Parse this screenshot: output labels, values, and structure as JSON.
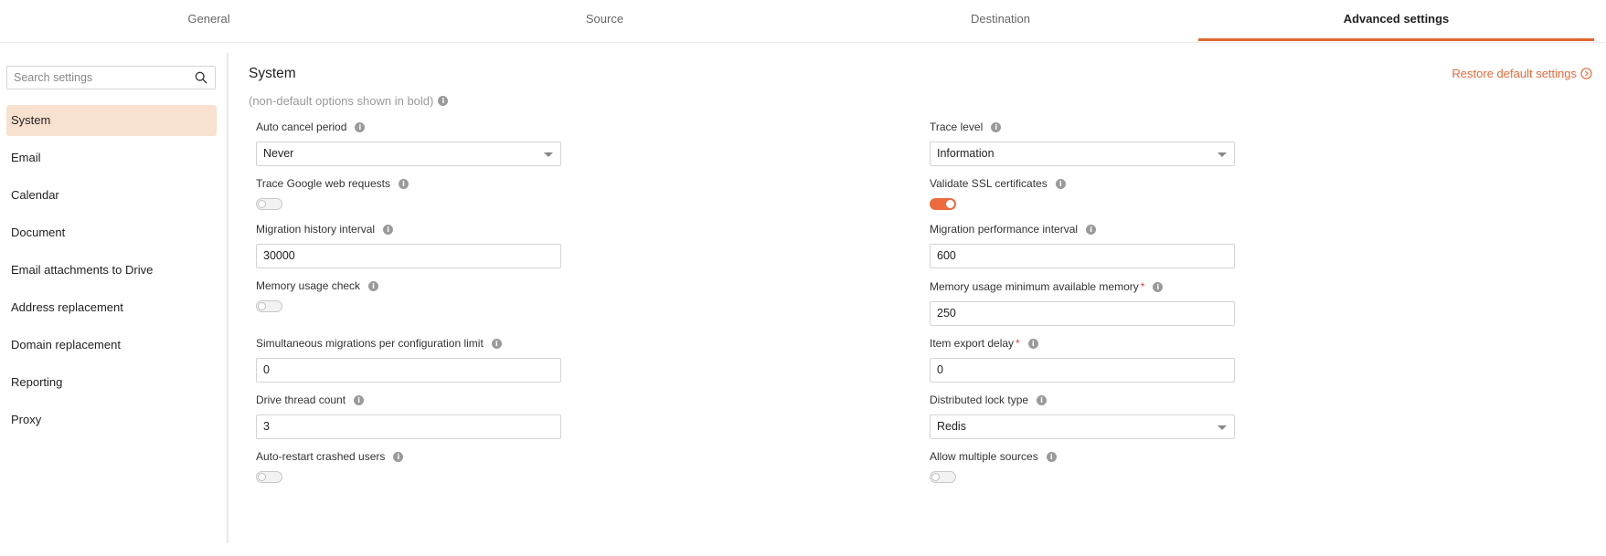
{
  "tabs": [
    {
      "label": "General"
    },
    {
      "label": "Source"
    },
    {
      "label": "Destination"
    },
    {
      "label": "Advanced settings",
      "active": true
    }
  ],
  "sidebar": {
    "search_placeholder": "Search settings",
    "items": [
      {
        "label": "System",
        "active": true
      },
      {
        "label": "Email"
      },
      {
        "label": "Calendar"
      },
      {
        "label": "Document"
      },
      {
        "label": "Email attachments to Drive"
      },
      {
        "label": "Address replacement"
      },
      {
        "label": "Domain replacement"
      },
      {
        "label": "Reporting"
      },
      {
        "label": "Proxy"
      }
    ]
  },
  "main": {
    "title": "System",
    "restore_label": "Restore default settings",
    "hint": "(non-default options shown in bold)",
    "left": {
      "auto_cancel_period": {
        "label": "Auto cancel period",
        "value": "Never"
      },
      "trace_google": {
        "label": "Trace Google web requests",
        "on": false
      },
      "migration_history_interval": {
        "label": "Migration history interval",
        "value": "30000"
      },
      "memory_usage_check": {
        "label": "Memory usage check",
        "on": false
      },
      "simultaneous_migrations": {
        "label": "Simultaneous migrations per configuration limit",
        "value": "0"
      },
      "drive_thread_count": {
        "label": "Drive thread count",
        "value": "3"
      },
      "auto_restart": {
        "label": "Auto-restart crashed users",
        "on": false
      }
    },
    "right": {
      "trace_level": {
        "label": "Trace level",
        "value": "Information"
      },
      "validate_ssl": {
        "label": "Validate SSL certificates",
        "on": true
      },
      "migration_performance_interval": {
        "label": "Migration performance interval",
        "value": "600"
      },
      "memory_min_available": {
        "label": "Memory usage minimum available memory",
        "required_mark": "*",
        "value": "250"
      },
      "item_export_delay": {
        "label": "Item export delay",
        "required_mark": "*",
        "value": "0"
      },
      "distributed_lock_type": {
        "label": "Distributed lock type",
        "value": "Redis"
      },
      "allow_multiple_sources": {
        "label": "Allow multiple sources",
        "on": false
      }
    }
  },
  "colors": {
    "accent": "#e0672b",
    "active_nav_bg": "#f9e1cf",
    "toggle_on": "#ec6a3d",
    "required": "#e23c3c"
  },
  "icons": {
    "search": "search-icon",
    "info": "info-icon",
    "restore": "arrow-circle-right-icon",
    "dropdown": "chevron-down-icon"
  }
}
